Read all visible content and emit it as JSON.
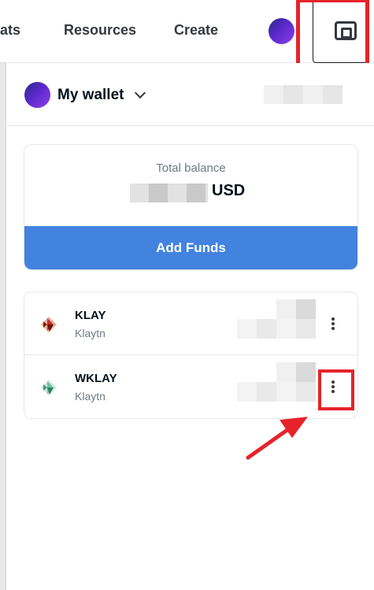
{
  "nav": {
    "links": [
      "tats",
      "Resources",
      "Create"
    ],
    "wallet_icon": "wallet-icon"
  },
  "wallet": {
    "title": "My wallet",
    "chevron_icon": "chevron-down-icon"
  },
  "balance": {
    "label": "Total balance",
    "currency": "USD",
    "add_funds_label": "Add Funds",
    "button_color": "#4283e0"
  },
  "tokens": [
    {
      "symbol": "KLAY",
      "chain": "Klaytn",
      "icon": "klay-logo-icon",
      "menu_icon": "more-vertical-icon"
    },
    {
      "symbol": "WKLAY",
      "chain": "Klaytn",
      "icon": "wklay-logo-icon",
      "menu_icon": "more-vertical-icon"
    }
  ],
  "annotations": {
    "highlight_color": "#e6232a"
  }
}
